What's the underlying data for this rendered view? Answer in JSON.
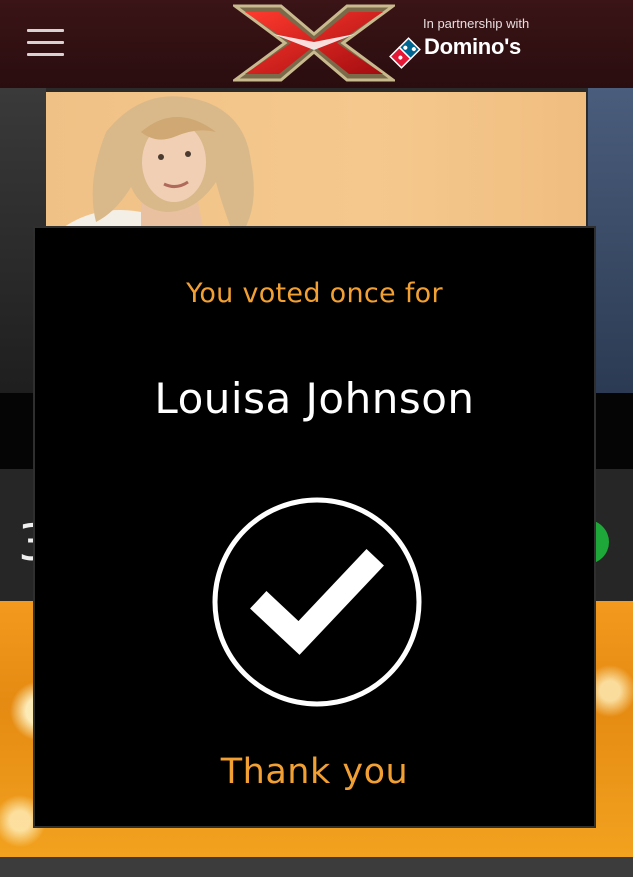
{
  "header": {
    "partner_caption": "In partnership with",
    "partner_name": "Domino's",
    "menu_icon": "hamburger-menu-icon",
    "logo_icon": "x-factor-logo"
  },
  "background": {
    "contestant_count": "3"
  },
  "modal": {
    "caption": "You voted once for",
    "contestant_name": "Louisa Johnson",
    "check_icon": "checkmark-circle-icon",
    "thanks": "Thank you"
  },
  "colors": {
    "accent_orange": "#f2a033",
    "modal_background": "#000000",
    "header_background": "#3a1416"
  }
}
